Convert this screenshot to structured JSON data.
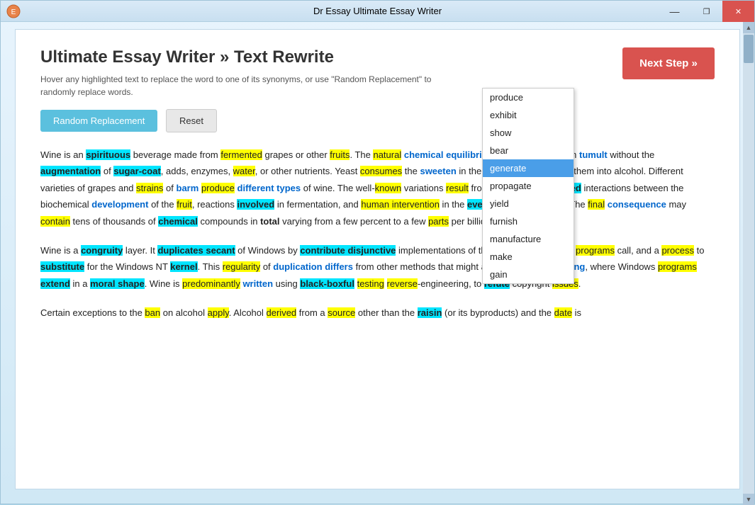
{
  "window": {
    "title": "Dr Essay Ultimate Essay Writer",
    "minimize_label": "—",
    "restore_label": "❐",
    "close_label": "✕"
  },
  "header": {
    "title": "Ultimate Essay Writer » Text Rewrite",
    "subtitle": "Hover any highlighted text to replace the word to one of its synonyms, or use \"Random Replacement\" to randomly replace words.",
    "next_step_label": "Next Step »"
  },
  "buttons": {
    "random_replacement": "Random Replacement",
    "reset": "Reset"
  },
  "dropdown": {
    "items": [
      {
        "label": "produce",
        "selected": false
      },
      {
        "label": "exhibit",
        "selected": false
      },
      {
        "label": "show",
        "selected": false
      },
      {
        "label": "bear",
        "selected": false
      },
      {
        "label": "generate",
        "selected": true
      },
      {
        "label": "propagate",
        "selected": false
      },
      {
        "label": "yield",
        "selected": false
      },
      {
        "label": "furnish",
        "selected": false
      },
      {
        "label": "manufacture",
        "selected": false
      },
      {
        "label": "make",
        "selected": false
      },
      {
        "label": "gain",
        "selected": false
      }
    ]
  },
  "essay": {
    "paragraph1": "Wine is an spirituous beverage made from fermented grapes or other fruits. The natural chemical equilibrium of grapes lets them tumult without the augmentation of sugar-coat, adds, enzymes, water, or other nutrients. Yeast consumes the sweeten in the grapes and translate them into alcohol. Different varieties of grapes and strains of barm produce different types of wine. The well-known variations result from the very complicated interactions between the biochemical development of the fruit, reactions involved in fermentation, and human intervention in the everywhere prosecute. The final consequence may contain tens of thousands of chemical compounds in total varying from a few percent to a few parts per billion.",
    "paragraph2": "Wine is a congruity layer. It duplicates secant of Windows by contribute disjunctive implementations of the DLLs that Windows programs call, and a process to substitute for the Windows NT kernel. This regularity of duplication differs from other methods that might also be considered vying, where Windows programs extend in a moral shape. Wine is predominantly written using black-boxful testing reverse-engineering, to refute copyright issues.",
    "paragraph3": "Certain exceptions to the ban on alcohol apply. Alcohol derived from a source other than the raisin (or its byproducts) and the date is"
  }
}
